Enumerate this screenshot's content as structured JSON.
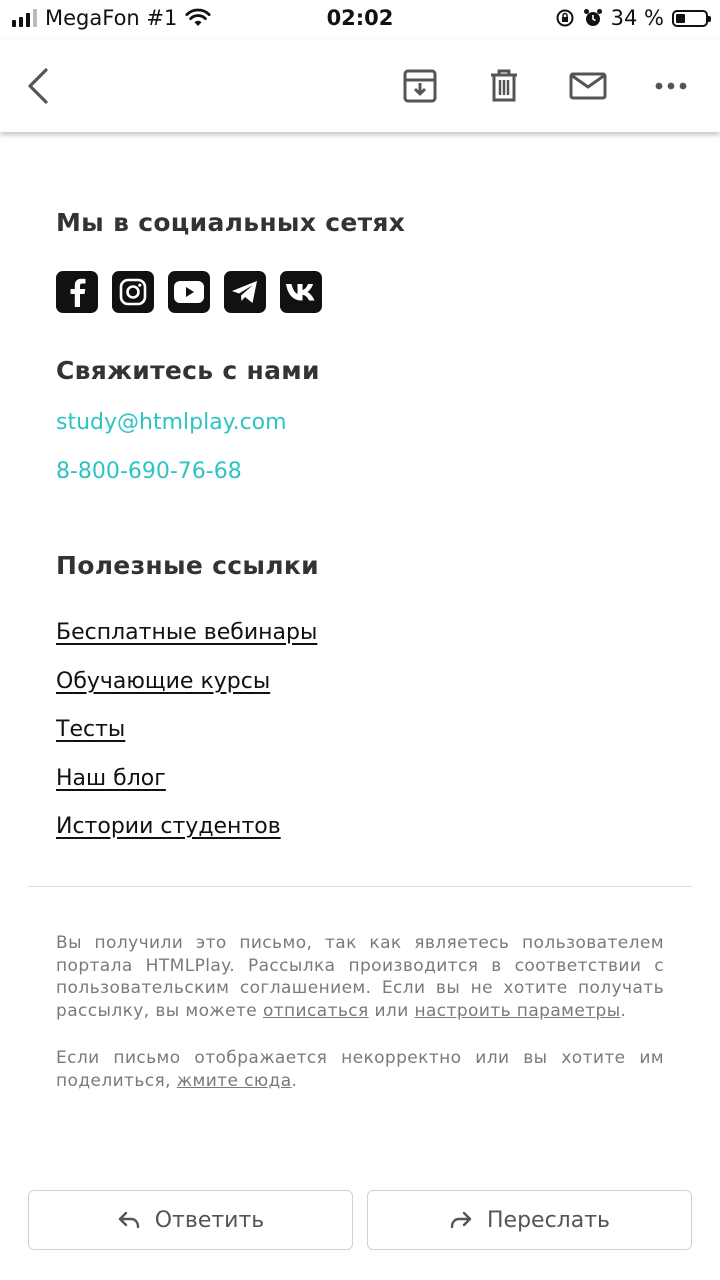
{
  "status_bar": {
    "carrier": "MegaFon #1",
    "time": "02:02",
    "battery": "34 %",
    "icons": [
      "signal-icon",
      "wifi-icon",
      "orientation-lock-icon",
      "alarm-icon",
      "battery-icon"
    ]
  },
  "toolbar": {
    "icons": [
      "back-arrow-icon",
      "archive-icon",
      "trash-icon",
      "mail-icon",
      "more-icon"
    ]
  },
  "social": {
    "heading": "Мы в социальных сетях",
    "networks": [
      "facebook-icon",
      "instagram-icon",
      "youtube-icon",
      "telegram-icon",
      "vk-icon"
    ]
  },
  "contact": {
    "heading": "Свяжитесь с нами",
    "email": "study@htmlplay.com",
    "phone": "8-800-690-76-68"
  },
  "links": {
    "heading": "Полезные ссылки",
    "items": [
      "Бесплатные вебинары",
      "Обучающие курсы",
      "Тесты",
      "Наш блог",
      "Истории студентов"
    ]
  },
  "footer": {
    "p1_text": "Вы получили это письмо, так как являетесь пользователем портала HTMLPlay. Рассылка производится в соответствии с пользовательским соглашением. Если вы не хотите получать рассылку, вы можете ",
    "unsubscribe": "отписаться",
    "or": " или ",
    "settings": "настроить параметры",
    "p1_end": ".",
    "p2_text": "Если письмо отображается некорректно или вы хотите им поделиться, ",
    "click_here": "жмите сюда",
    "p2_end": "."
  },
  "actions": {
    "reply": "Ответить",
    "forward": "Переслать"
  },
  "colors": {
    "accent": "#2ec4c4",
    "text": "#222222",
    "muted": "#7a7a7a"
  }
}
